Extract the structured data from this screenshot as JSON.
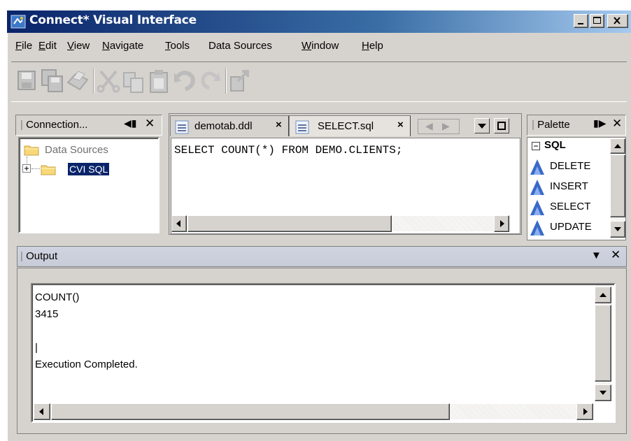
{
  "window": {
    "title": "Connect* Visual Interface"
  },
  "menu": [
    {
      "label": "File",
      "mnemonic": "F",
      "rest": "ile"
    },
    {
      "label": "Edit",
      "mnemonic": "E",
      "rest": "dit"
    },
    {
      "label": "View",
      "mnemonic": "V",
      "rest": "iew"
    },
    {
      "label": "Navigate",
      "mnemonic": "N",
      "rest": "avigate"
    },
    {
      "label": "Tools",
      "mnemonic": "T",
      "rest": "ools"
    },
    {
      "label": "Data Sources",
      "mnemonic": "",
      "rest": "Data Sources"
    },
    {
      "label": "Window",
      "mnemonic": "W",
      "rest": "indow"
    },
    {
      "label": "Help",
      "mnemonic": "H",
      "rest": "elp"
    }
  ],
  "toolbar": {
    "icons": [
      "save-icon",
      "save-all-icon",
      "print-icon",
      "cut-icon",
      "copy-icon",
      "paste-icon",
      "undo-icon",
      "redo-icon",
      "export-icon"
    ]
  },
  "connections": {
    "header": "Connection...",
    "root": "Data Sources",
    "child": "CVI SQL"
  },
  "editor": {
    "tabs": [
      {
        "label": "demotab.ddl"
      },
      {
        "label": "SELECT.sql"
      }
    ],
    "content": "SELECT COUNT(*) FROM DEMO.CLIENTS;"
  },
  "palette": {
    "header": "Palette",
    "group": "SQL",
    "items": [
      "DELETE",
      "INSERT",
      "SELECT",
      "UPDATE"
    ]
  },
  "output": {
    "header": "Output",
    "lines": [
      "COUNT()",
      "3415",
      "",
      "|",
      "Execution Completed."
    ]
  },
  "colors": {
    "face": "#d6d3ce",
    "title_start": "#0a246a",
    "title_end": "#a6caf0",
    "selection": "#0a246a"
  }
}
